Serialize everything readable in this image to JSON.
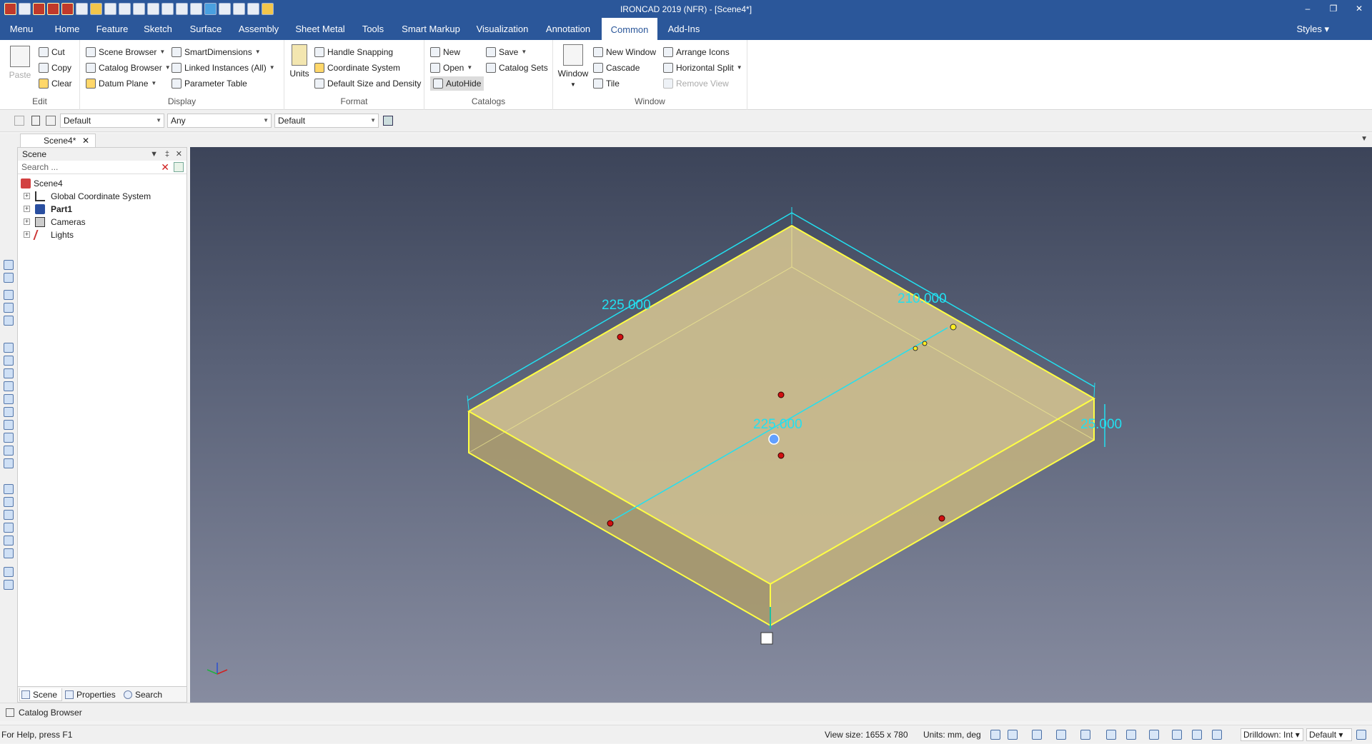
{
  "window": {
    "title": "IRONCAD 2019 (NFR) - [Scene4*]"
  },
  "menubar": {
    "tabs": [
      "Menu",
      "Home",
      "Feature",
      "Sketch",
      "Surface",
      "Assembly",
      "Sheet Metal",
      "Tools",
      "Smart Markup",
      "Visualization",
      "Annotation",
      "Common",
      "Add-Ins"
    ],
    "active": "Common",
    "styles_label": "Styles"
  },
  "ribbon": {
    "edit": {
      "label": "Edit",
      "paste": "Paste",
      "cut": "Cut",
      "copy": "Copy",
      "clear": "Clear"
    },
    "display": {
      "label": "Display",
      "scene_browser": "Scene Browser",
      "catalog_browser": "Catalog Browser",
      "datum_plane": "Datum Plane",
      "smart_dimensions": "SmartDimensions",
      "linked_instances": "Linked Instances (All)",
      "parameter_table": "Parameter Table"
    },
    "format": {
      "label": "Format",
      "units": "Units",
      "handle_snapping": "Handle Snapping",
      "coordinate_system": "Coordinate System",
      "default_size": "Default Size and Density"
    },
    "catalogs": {
      "label": "Catalogs",
      "new": "New",
      "open": "Open",
      "autohide": "AutoHide",
      "save": "Save",
      "catalog_sets": "Catalog Sets"
    },
    "window": {
      "label": "Window",
      "window": "Window",
      "new_window": "New Window",
      "cascade": "Cascade",
      "tile": "Tile",
      "arrange_icons": "Arrange Icons",
      "horizontal_split": "Horizontal Split",
      "remove_view": "Remove View"
    }
  },
  "toolbar2": {
    "combo1": "Default",
    "combo2": "Any",
    "combo3": "Default"
  },
  "doc_tab": {
    "label": "Scene4*"
  },
  "scene_panel": {
    "title": "Scene",
    "search_placeholder": "Search ...",
    "tree": [
      {
        "label": "Scene4",
        "bold": false,
        "level": 0
      },
      {
        "label": "Global Coordinate System",
        "bold": false,
        "level": 1
      },
      {
        "label": "Part1",
        "bold": true,
        "level": 1
      },
      {
        "label": "Cameras",
        "bold": false,
        "level": 1
      },
      {
        "label": "Lights",
        "bold": false,
        "level": 1
      }
    ],
    "tabs": [
      "Scene",
      "Properties",
      "Search"
    ]
  },
  "viewport": {
    "dimensions": {
      "top_left": "225.000",
      "top_right": "210.000",
      "center": "225.000",
      "right_height": "25.000"
    },
    "colors": {
      "box_top": "#c9b98a",
      "box_edge": "#ffff44",
      "dimension": "#22e0f0"
    }
  },
  "catalog_bar": {
    "label": "Catalog Browser"
  },
  "statusbar": {
    "help": "For Help, press F1",
    "view_size": "View size: 1655 x 780",
    "units": "Units: mm, deg",
    "drilldown": "Drilldown: Int",
    "style": "Default"
  }
}
